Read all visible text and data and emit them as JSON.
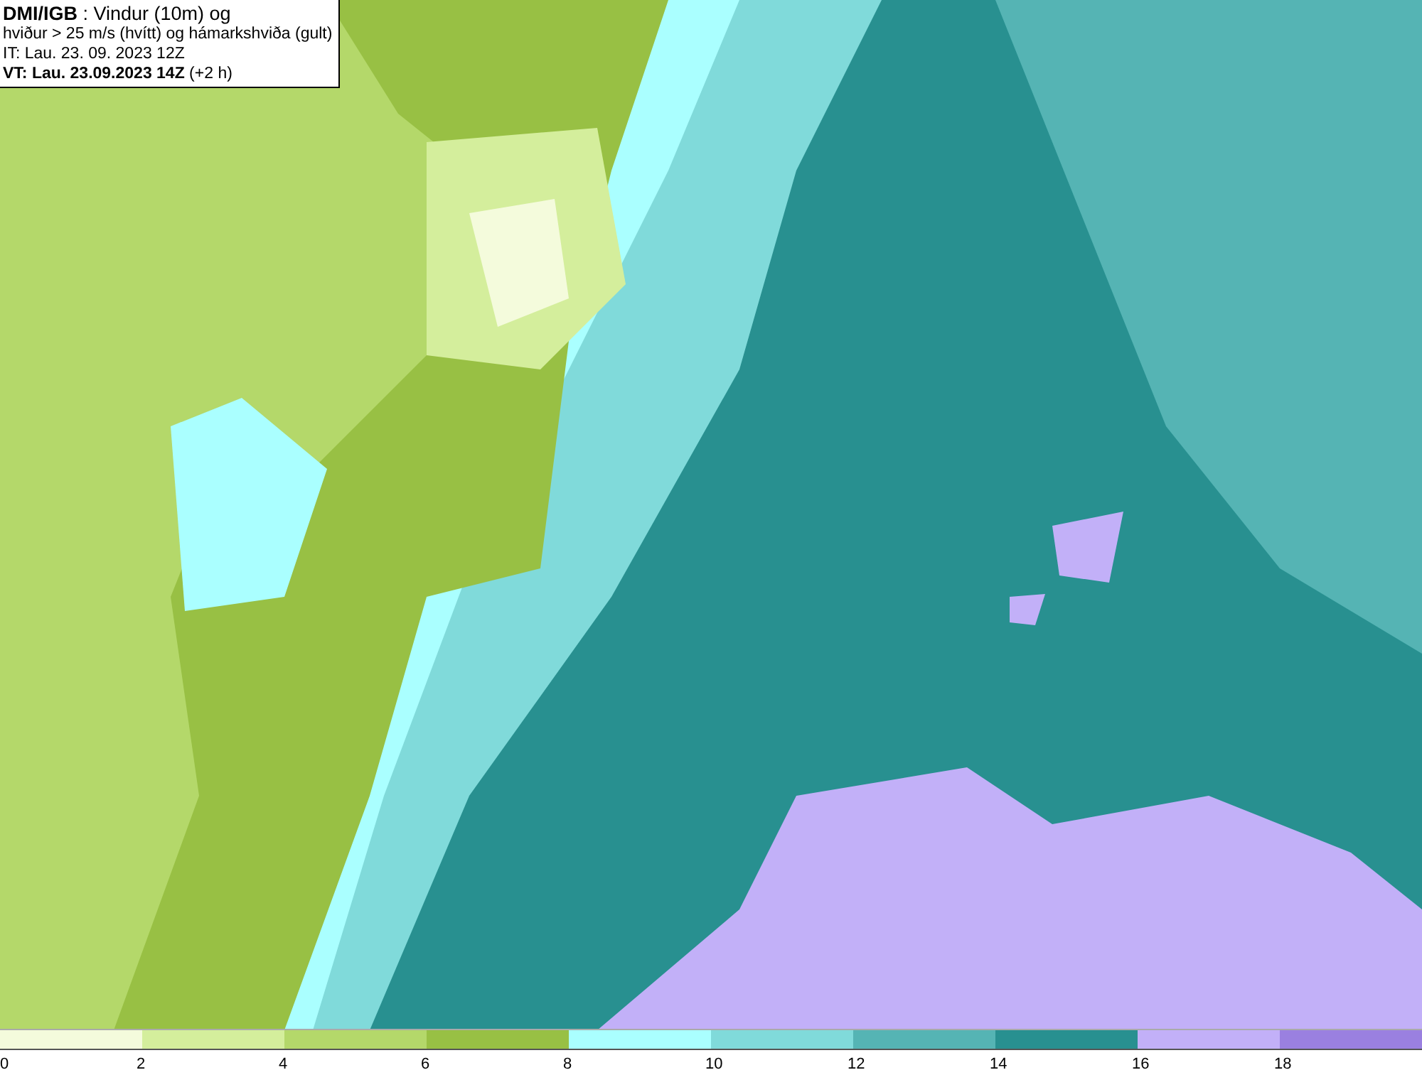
{
  "header": {
    "lines": [
      "**DMI/IGB** : Vindur (10m) og",
      "hviður > 25 m/s (hvítt) og hámarkshviða (gult)",
      "IT: Lau. 23. 09. 2023 12Z",
      "**VT: Lau. 23.09.2023 14Z** (+2 h)"
    ]
  },
  "legend": {
    "items": [
      {
        "label": "0",
        "color": "#f4fbdc"
      },
      {
        "label": "2",
        "color": "#d4ee9c"
      },
      {
        "label": "4",
        "color": "#b4d86a"
      },
      {
        "label": "6",
        "color": "#98c044"
      },
      {
        "label": "8",
        "color": "#aaffff"
      },
      {
        "label": "10",
        "color": "#80dada"
      },
      {
        "label": "12",
        "color": "#55b4b4"
      },
      {
        "label": "14",
        "color": "#289090"
      },
      {
        "label": "16",
        "color": "#c2b0f8"
      },
      {
        "label": "18",
        "color": "#9a80e0"
      }
    ]
  }
}
